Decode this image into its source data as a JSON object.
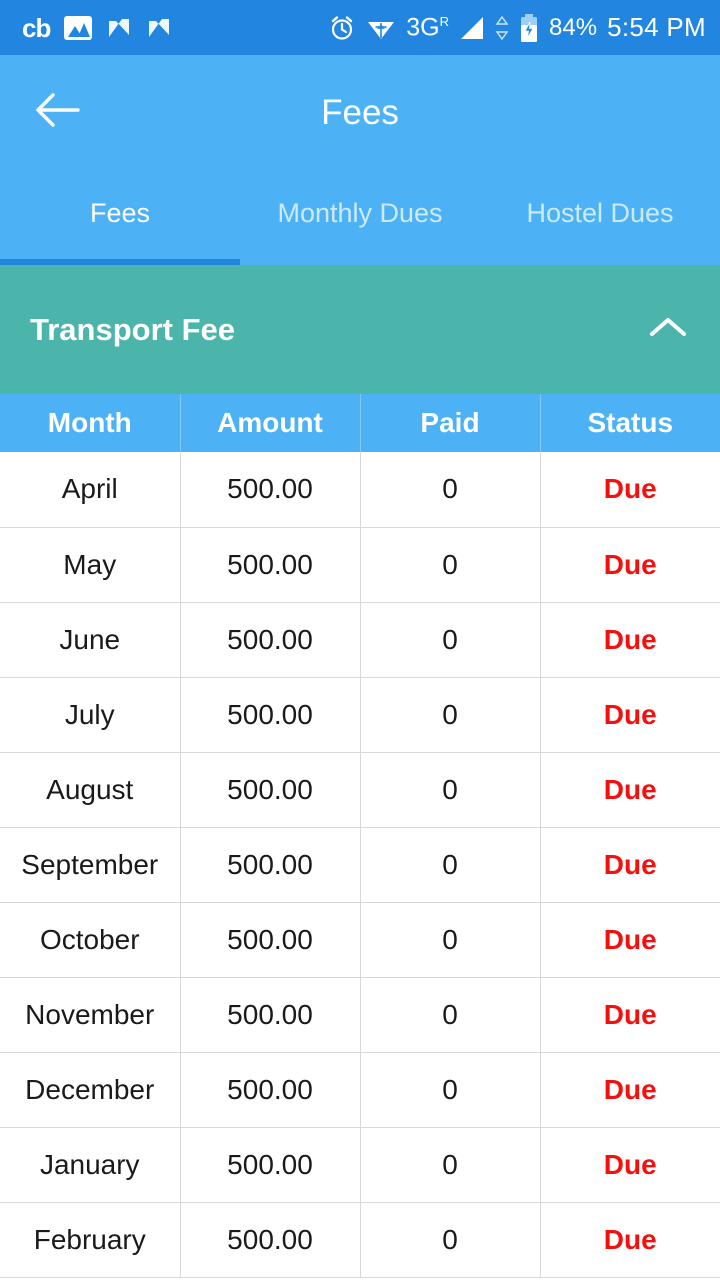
{
  "status_bar": {
    "left_icons": [
      {
        "name": "cb-app-icon",
        "glyph": "cb"
      },
      {
        "name": "photo-icon",
        "glyph": "image"
      },
      {
        "name": "nougat-icon-1",
        "glyph": "N"
      },
      {
        "name": "nougat-icon-2",
        "glyph": "N"
      }
    ],
    "right_icons": [
      {
        "name": "alarm-icon",
        "glyph": "alarm"
      },
      {
        "name": "wifi-icon",
        "glyph": "wifi"
      },
      {
        "name": "signal-icon",
        "glyph": "signal"
      },
      {
        "name": "data-transfer-icon",
        "glyph": "up-down"
      },
      {
        "name": "battery-charging-icon",
        "glyph": "battery"
      }
    ],
    "network_type": "3G",
    "network_roaming": "R",
    "battery_percent": "84%",
    "clock": "5:54 PM"
  },
  "appbar": {
    "back_icon": "arrow-left-icon",
    "title": "Fees"
  },
  "tabs": {
    "items": [
      {
        "label": "Fees",
        "active": true
      },
      {
        "label": "Monthly Dues",
        "active": false
      },
      {
        "label": "Hostel Dues",
        "active": false
      }
    ],
    "indicator_color": "#2286E0"
  },
  "section": {
    "title": "Transport Fee",
    "expanded": true,
    "chevron_icon": "chevron-up-icon",
    "background_color": "#4BB5AC"
  },
  "table": {
    "headers": [
      "Month",
      "Amount",
      "Paid",
      "Status"
    ],
    "header_background": "#4DB2F5",
    "due_color": "#f2110f",
    "rows": [
      {
        "month": "April",
        "amount": "500.00",
        "paid": "0",
        "status": "Due"
      },
      {
        "month": "May",
        "amount": "500.00",
        "paid": "0",
        "status": "Due"
      },
      {
        "month": "June",
        "amount": "500.00",
        "paid": "0",
        "status": "Due"
      },
      {
        "month": "July",
        "amount": "500.00",
        "paid": "0",
        "status": "Due"
      },
      {
        "month": "August",
        "amount": "500.00",
        "paid": "0",
        "status": "Due"
      },
      {
        "month": "September",
        "amount": "500.00",
        "paid": "0",
        "status": "Due"
      },
      {
        "month": "October",
        "amount": "500.00",
        "paid": "0",
        "status": "Due"
      },
      {
        "month": "November",
        "amount": "500.00",
        "paid": "0",
        "status": "Due"
      },
      {
        "month": "December",
        "amount": "500.00",
        "paid": "0",
        "status": "Due"
      },
      {
        "month": "January",
        "amount": "500.00",
        "paid": "0",
        "status": "Due"
      },
      {
        "month": "February",
        "amount": "500.00",
        "paid": "0",
        "status": "Due"
      }
    ]
  }
}
